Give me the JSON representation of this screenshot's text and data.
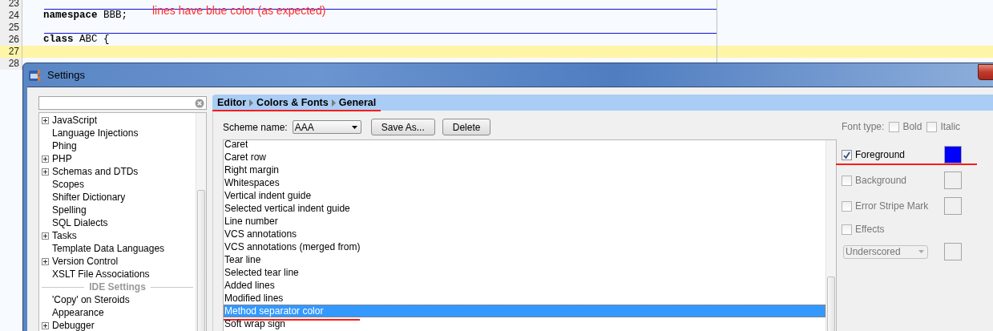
{
  "editor": {
    "annotation": "lines have blue color (as expected)",
    "lines": [
      {
        "number": "23",
        "separator_above": false,
        "current": false
      },
      {
        "number": "24",
        "code": "**namespace** BBB;",
        "separator_above": true,
        "current": false
      },
      {
        "number": "25",
        "separator_above": false,
        "current": false
      },
      {
        "number": "26",
        "code": "**class** ABC {",
        "separator_above": true,
        "current": false
      },
      {
        "number": "27",
        "separator_above": false,
        "current": true
      },
      {
        "number": "28",
        "separator_above": false,
        "current": false
      }
    ]
  },
  "dialog": {
    "title": "Settings",
    "tree": [
      {
        "label": "JavaScript",
        "kind": "group"
      },
      {
        "label": "Language Injections",
        "kind": "leaf"
      },
      {
        "label": "Phing",
        "kind": "leaf"
      },
      {
        "label": "PHP",
        "kind": "group"
      },
      {
        "label": "Schemas and DTDs",
        "kind": "group"
      },
      {
        "label": "Scopes",
        "kind": "leaf"
      },
      {
        "label": "Shifter Dictionary",
        "kind": "leaf"
      },
      {
        "label": "Spelling",
        "kind": "leaf"
      },
      {
        "label": "SQL Dialects",
        "kind": "leaf"
      },
      {
        "label": "Tasks",
        "kind": "group"
      },
      {
        "label": "Template Data Languages",
        "kind": "leaf"
      },
      {
        "label": "Version Control",
        "kind": "group"
      },
      {
        "label": "XSLT File Associations",
        "kind": "leaf"
      },
      {
        "label": "IDE Settings",
        "kind": "header"
      },
      {
        "label": "'Copy' on Steroids",
        "kind": "leaf"
      },
      {
        "label": "Appearance",
        "kind": "leaf"
      },
      {
        "label": "Debugger",
        "kind": "group"
      }
    ],
    "breadcrumb": {
      "parts": [
        "Editor",
        "Colors & Fonts",
        "General"
      ],
      "underlined": true
    },
    "scheme": {
      "label": "Scheme name:",
      "value": "AAA"
    },
    "buttons": [
      "Save As...",
      "Delete"
    ],
    "elements": [
      {
        "label": "Caret",
        "selected": false
      },
      {
        "label": "Caret row",
        "selected": false
      },
      {
        "label": "Right margin",
        "selected": false
      },
      {
        "label": "Whitespaces",
        "selected": false
      },
      {
        "label": "Vertical indent guide",
        "selected": false
      },
      {
        "label": "Selected vertical indent guide",
        "selected": false
      },
      {
        "label": "Line number",
        "selected": false
      },
      {
        "label": "VCS annotations",
        "selected": false
      },
      {
        "label": "VCS annotations (merged from)",
        "selected": false
      },
      {
        "label": "Tear line",
        "selected": false
      },
      {
        "label": "Selected tear line",
        "selected": false
      },
      {
        "label": "Added lines",
        "selected": false
      },
      {
        "label": "Modified lines",
        "selected": false
      },
      {
        "label": "Method separator color",
        "selected": true,
        "underlined": true
      },
      {
        "label": "Soft wrap sign",
        "selected": false
      }
    ],
    "font_type": {
      "label": "Font type:",
      "options": [
        {
          "label": "Bold",
          "checked": false,
          "disabled": true
        },
        {
          "label": "Italic",
          "checked": false,
          "disabled": true
        }
      ]
    },
    "attributes": [
      {
        "label": "Foreground",
        "checked": true,
        "color": "#0000ff",
        "underlined": true
      },
      {
        "label": "Background",
        "checked": false
      },
      {
        "label": "Error Stripe Mark",
        "checked": false
      },
      {
        "label": "Effects",
        "checked": false,
        "kind": "effects"
      }
    ],
    "effect_type": {
      "value": "Underscored",
      "disabled": true
    }
  }
}
